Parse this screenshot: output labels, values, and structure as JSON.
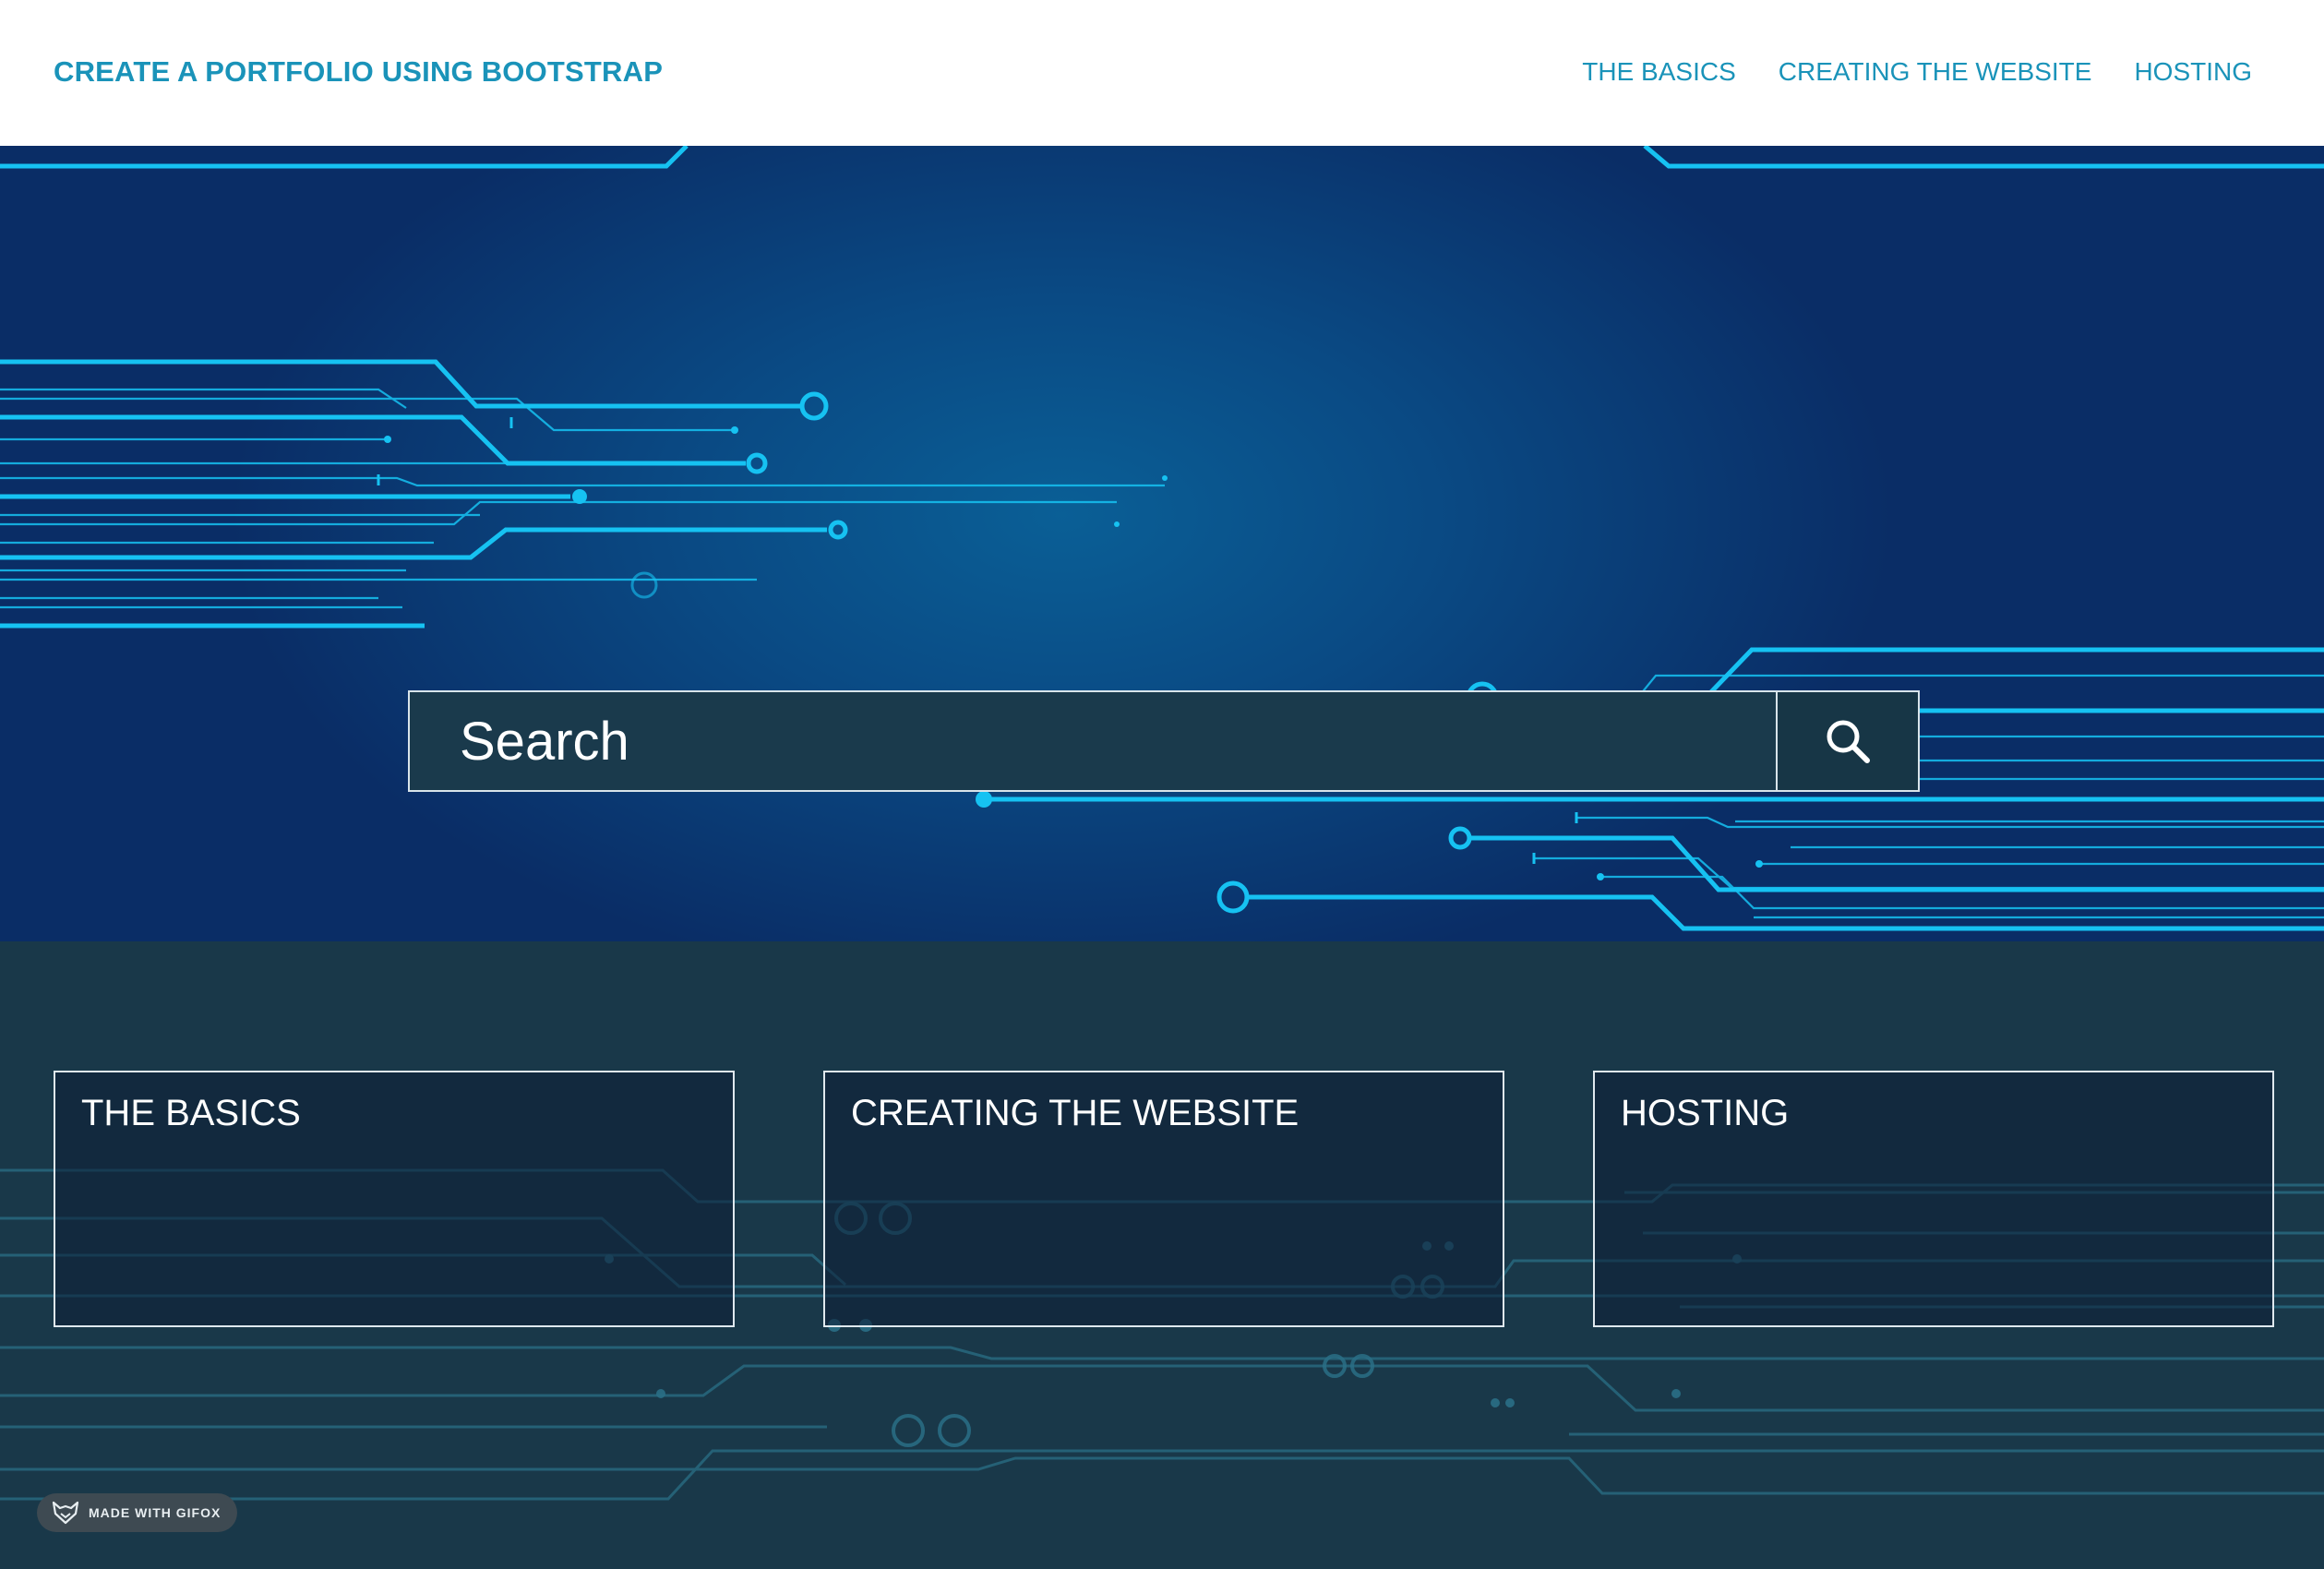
{
  "navbar": {
    "brand": "CREATE A PORTFOLIO USING BOOTSTRAP",
    "links": [
      "THE BASICS",
      "CREATING THE WEBSITE",
      "HOSTING"
    ]
  },
  "search": {
    "placeholder": "Search",
    "button_icon": "search-icon"
  },
  "cards": [
    {
      "title": "THE BASICS"
    },
    {
      "title": "CREATING THE WEBSITE"
    },
    {
      "title": "HOSTING"
    }
  ],
  "badge": {
    "label": "MADE WITH GIFOX",
    "icon": "fox-icon"
  },
  "colors": {
    "brand": "#1a93b9",
    "hero_bg": "#0a4a84",
    "circuit_line": "#16c2f2",
    "lower_bg": "#193849",
    "card_border": "#dfe8ee"
  }
}
